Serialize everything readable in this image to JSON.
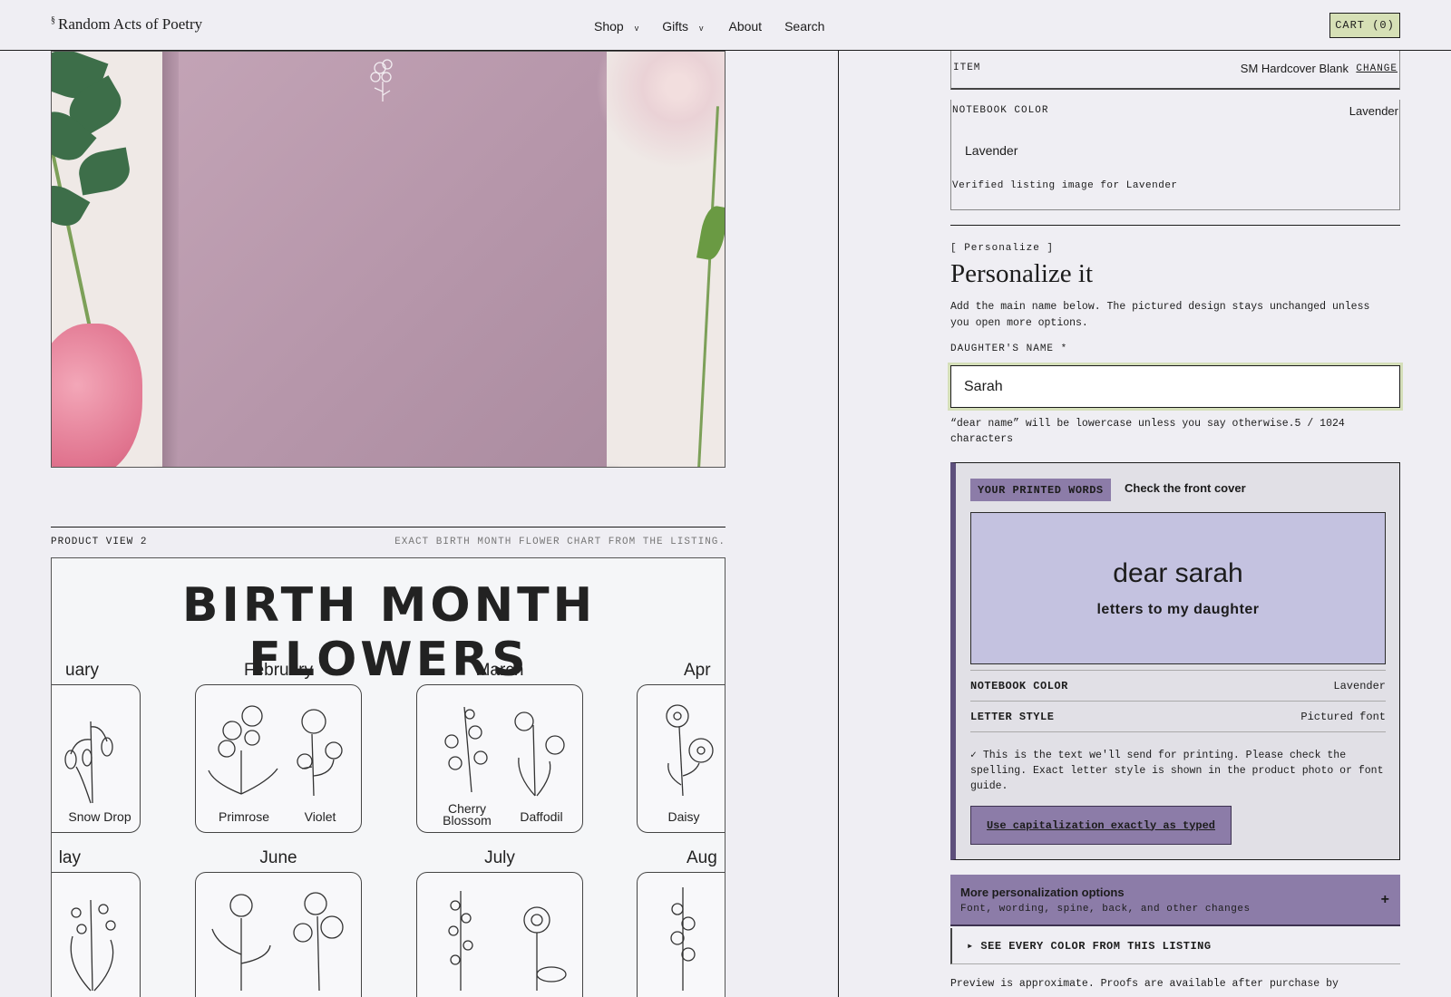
{
  "header": {
    "logo_mark": "§",
    "logo": "Random Acts of Poetry",
    "nav": [
      {
        "label": "Shop",
        "chevron": "v"
      },
      {
        "label": "Gifts",
        "chevron": "v"
      },
      {
        "label": "About"
      },
      {
        "label": "Search"
      }
    ],
    "cart_label": "CART (0)"
  },
  "gallery": {
    "view2_label": "PRODUCT VIEW 2",
    "view2_caption": "EXACT BIRTH MONTH FLOWER CHART FROM THE LISTING.",
    "chart_title": "BIRTH MONTH FLOWERS",
    "months": [
      "uary",
      "February",
      "March",
      "Apr",
      "lay",
      "June",
      "July",
      "Aug"
    ],
    "flowers": {
      "jan": [
        "Snow Drop"
      ],
      "feb": [
        "Primrose",
        "Violet"
      ],
      "mar": [
        "Cherry Blossom",
        "Daffodil"
      ],
      "apr": [
        "Daisy"
      ]
    }
  },
  "summary": {
    "item_label": "ITEM",
    "item_value": "SM Hardcover Blank",
    "change_label": "CHANGE",
    "color_label": "NOTEBOOK COLOR",
    "color_value": "Lavender",
    "color_selected": "Lavender",
    "verified_text": "Verified listing image for Lavender"
  },
  "personalize": {
    "crumb": "[ Personalize ]",
    "heading": "Personalize it",
    "description": "Add the main name below. The pictured design stays unchanged unless you open more options.",
    "field_label": "DAUGHTER'S NAME *",
    "field_value": "Sarah",
    "hint": "“dear name” will be lowercase unless you say otherwise.5 / 1024 characters"
  },
  "printed": {
    "tag": "YOUR PRINTED WORDS",
    "tag_side": "Check the front cover",
    "cover_line1": "dear sarah",
    "cover_line2": "letters to my daughter",
    "rows": [
      {
        "key": "NOTEBOOK COLOR",
        "value": "Lavender"
      },
      {
        "key": "LETTER STYLE",
        "value": "Pictured font"
      }
    ],
    "note": "✓ This is the text we'll send for printing. Please check the spelling. Exact letter style is shown in the product photo or font guide.",
    "button": "Use capitalization exactly as typed"
  },
  "more_options": {
    "title": "More personalization options",
    "subtitle": "Font, wording, spine, back, and other changes",
    "toggle": "+"
  },
  "all_colors": "▸ SEE EVERY COLOR FROM THIS LISTING",
  "footnote": "Preview is approximate. Proofs are available after purchase by",
  "colors": {
    "lavender_cover": "#c4c2e0",
    "accent_purple": "#8c7ca8",
    "cart_green": "#d6e0b6"
  }
}
